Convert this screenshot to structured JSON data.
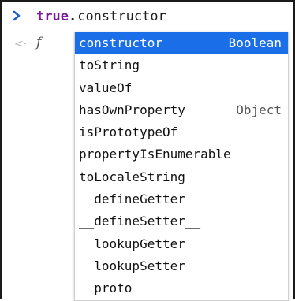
{
  "console": {
    "input_keyword": "true",
    "input_dot": ".",
    "input_rest": "constructor",
    "result_glyph": "f"
  },
  "suggestions": [
    {
      "label": "constructor",
      "type": "Boolean",
      "selected": true
    },
    {
      "label": "toString",
      "type": ""
    },
    {
      "label": "valueOf",
      "type": ""
    },
    {
      "label": "hasOwnProperty",
      "type": "Object"
    },
    {
      "label": "isPrototypeOf",
      "type": ""
    },
    {
      "label": "propertyIsEnumerable",
      "type": ""
    },
    {
      "label": "toLocaleString",
      "type": ""
    },
    {
      "label": "__defineGetter__",
      "type": ""
    },
    {
      "label": "__defineSetter__",
      "type": ""
    },
    {
      "label": "__lookupGetter__",
      "type": ""
    },
    {
      "label": "__lookupSetter__",
      "type": ""
    },
    {
      "label": "__proto__",
      "type": ""
    }
  ],
  "colors": {
    "selected_bg": "#1a6ee8",
    "keyword": "#7a1b9c",
    "prompt_arrow": "#1a5fd6"
  },
  "icons": {
    "prompt": "chevron-right-icon",
    "result": "chevron-left-icon"
  }
}
